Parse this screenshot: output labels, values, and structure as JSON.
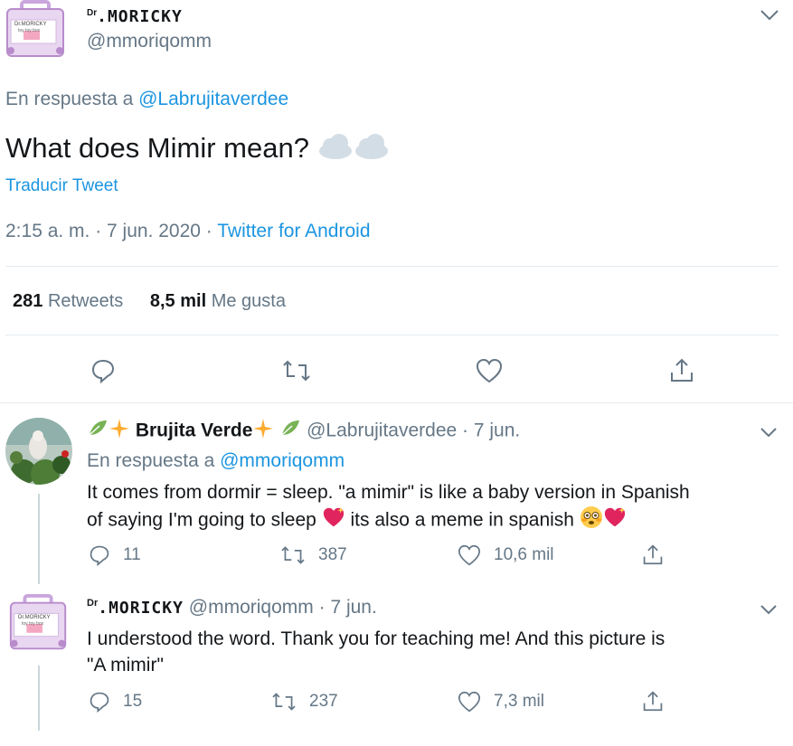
{
  "main_tweet": {
    "display_name_prefix": "Dr",
    "display_name": ".MORICKY",
    "handle": "@mmoriqomm",
    "reply_prefix": "En respuesta a",
    "reply_to": "@Labrujitaverdee",
    "text": "What does Mimir mean?",
    "translate_label": "Traducir Tweet",
    "timestamp": "2:15 a. m. · 7 jun. 2020 ·",
    "source": "Twitter for Android",
    "retweets_count": "281",
    "retweets_label": "Retweets",
    "likes_count": "8,5 mil",
    "likes_label": "Me gusta",
    "avatar_text_line1": "Dr.MORICKY",
    "avatar_text_line2": "toy toy box"
  },
  "reply1": {
    "display_name": "Brujita Verde",
    "handle": "@Labrujitaverdee",
    "date": "· 7 jun.",
    "reply_prefix": "En respuesta a",
    "reply_to": "@mmoriqomm",
    "text_line1": "It comes from dormir = sleep. \"a mimir\" is like a baby version in Spanish",
    "text_line2a": "of saying I'm going to sleep",
    "text_line2b": "its also a meme in spanish",
    "reply_count": "11",
    "retweet_count": "387",
    "like_count": "10,6 mil"
  },
  "reply2": {
    "display_name_prefix": "Dr",
    "display_name": ".MORICKY",
    "handle": "@mmoriqomm",
    "date": "· 7 jun.",
    "text_line1": "I understood the word. Thank you for teaching me! And this picture is",
    "text_line2": "\"A mimir\"",
    "reply_count": "15",
    "retweet_count": "237",
    "like_count": "7,3 mil"
  },
  "colors": {
    "link": "#1b95e0",
    "muted": "#657786",
    "divider": "#e6ecf0",
    "heart_emoji": "#e0245e",
    "sparkle": "#ffac33",
    "leaf": "#77b255"
  }
}
